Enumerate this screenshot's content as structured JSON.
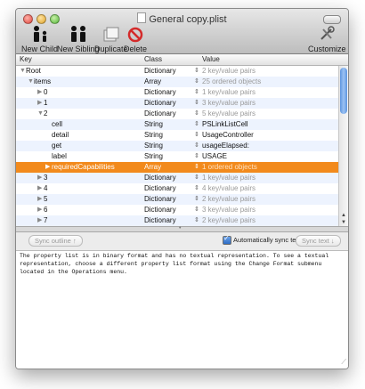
{
  "window": {
    "title": "General copy.plist"
  },
  "toolbar": {
    "new_child": "New Child",
    "new_sibling": "New Sibling",
    "duplicate": "Duplicate",
    "delete": "Delete",
    "customize": "Customize"
  },
  "columns": {
    "key": "Key",
    "class": "Class",
    "value": "Value"
  },
  "rows": [
    {
      "key": "Root",
      "class": "Dictionary",
      "value": "2 key/value pairs"
    },
    {
      "key": "items",
      "class": "Array",
      "value": "25 ordered objects"
    },
    {
      "key": "0",
      "class": "Dictionary",
      "value": "1 key/value pairs"
    },
    {
      "key": "1",
      "class": "Dictionary",
      "value": "3 key/value pairs"
    },
    {
      "key": "2",
      "class": "Dictionary",
      "value": "5 key/value pairs"
    },
    {
      "key": "cell",
      "class": "String",
      "value": "PSLinkListCell"
    },
    {
      "key": "detail",
      "class": "String",
      "value": "UsageController"
    },
    {
      "key": "get",
      "class": "String",
      "value": "usageElapsed:"
    },
    {
      "key": "label",
      "class": "String",
      "value": "USAGE"
    },
    {
      "key": "requiredCapabilities",
      "class": "Array",
      "value": "1 ordered objects"
    },
    {
      "key": "3",
      "class": "Dictionary",
      "value": "1 key/value pairs"
    },
    {
      "key": "4",
      "class": "Dictionary",
      "value": "4 key/value pairs"
    },
    {
      "key": "5",
      "class": "Dictionary",
      "value": "2 key/value pairs"
    },
    {
      "key": "6",
      "class": "Dictionary",
      "value": "3 key/value pairs"
    },
    {
      "key": "7",
      "class": "Dictionary",
      "value": "2 key/value pairs"
    }
  ],
  "sync": {
    "outline_button": "Sync outline ↑",
    "auto_label": "Automatically sync text",
    "auto_checked": true,
    "text_button": "Sync text ↓"
  },
  "text_area": "The property list is in binary format and has no textual representation.  To see a textual representation, choose a different property list format using the Change Format submenu located in the Operations menu.",
  "colors": {
    "selection": "#f28a1c",
    "alt_row": "#edf3fe",
    "scroll_thumb": "#6fa2e6"
  }
}
